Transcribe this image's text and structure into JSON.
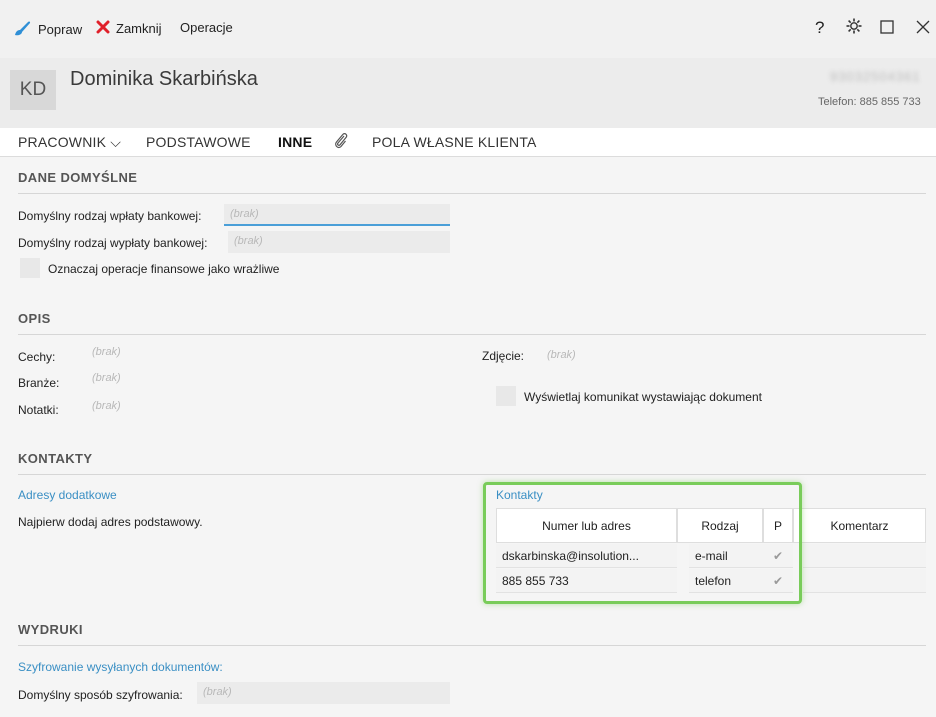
{
  "toolbar": {
    "edit_label": "Popraw",
    "close_label": "Zamknij",
    "operations_label": "Operacje",
    "help_glyph": "?",
    "settings_glyph": "⚙",
    "maximize_glyph": "☐",
    "window_close_glyph": "✕"
  },
  "header": {
    "initials": "KD",
    "name": "Dominika  Skarbińska",
    "blurred_id": "93032504361",
    "phone_line": "Telefon: 885 855 733"
  },
  "tabs": [
    {
      "label": "PRACOWNIK ⌵"
    },
    {
      "label": "PODSTAWOWE"
    },
    {
      "label": "INNE"
    },
    {
      "label": "POLA WŁASNE KLIENTA"
    }
  ],
  "sections": {
    "dane": {
      "title": "DANE DOMYŚLNE",
      "deposit_label": "Domyślny rodzaj wpłaty bankowej:",
      "deposit_value": "(brak)",
      "withdraw_label": "Domyślny rodzaj wypłaty bankowej:",
      "withdraw_value": "(brak)",
      "sensitive_label": "Oznaczaj operacje finansowe jako wrażliwe"
    },
    "opis": {
      "title": "OPIS",
      "cechy_label": "Cechy:",
      "cechy_value": "(brak)",
      "branze_label": "Branże:",
      "branze_value": "(brak)",
      "notatki_label": "Notatki:",
      "notatki_value": "(brak)",
      "zdjecie_label": "Zdjęcie:",
      "zdjecie_value": "(brak)",
      "show_message_label": "Wyświetlaj komunikat wystawiając dokument"
    },
    "kontakty": {
      "title": "KONTAKTY",
      "addresses_link": "Adresy dodatkowe",
      "addresses_note": "Najpierw dodaj adres podstawowy.",
      "contacts_link": "Kontakty",
      "columns": [
        "Numer lub adres",
        "Rodzaj",
        "P",
        "Komentarz"
      ],
      "rows": [
        {
          "address": "dskarbinska@insolution...",
          "type": "e-mail",
          "primary": "✔",
          "comment": ""
        },
        {
          "address": "885 855 733",
          "type": "telefon",
          "primary": "✔",
          "comment": ""
        }
      ]
    },
    "wydruki": {
      "title": "WYDRUKI",
      "encryption_link": "Szyfrowanie wysyłanych dokumentów:",
      "encryption_label": "Domyślny sposób szyfrowania:",
      "encryption_value": "(brak)"
    }
  },
  "colors": {
    "accent_blue": "#3a8fc4",
    "highlight_green": "#79cc5a",
    "close_red": "#e0202a"
  }
}
